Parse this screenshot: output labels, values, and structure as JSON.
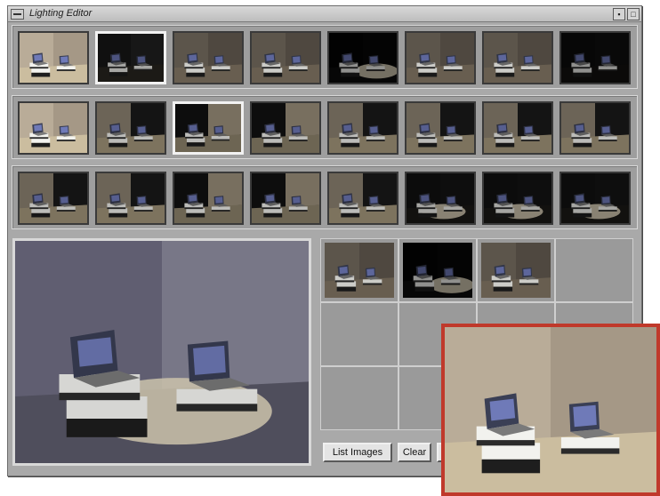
{
  "window": {
    "title": "Lighting Editor",
    "menu_icon": "window-menu-icon",
    "buttons": [
      "minimize-icon",
      "maximize-icon"
    ]
  },
  "rows": [
    {
      "thumbs": [
        {
          "light": "front",
          "selected": false
        },
        {
          "light": "dark-left",
          "selected": true
        },
        {
          "light": "dim-front",
          "selected": false
        },
        {
          "light": "dim-front",
          "selected": false
        },
        {
          "light": "spot-right",
          "selected": false
        },
        {
          "light": "dim-front",
          "selected": false
        },
        {
          "light": "dim-front",
          "selected": false
        },
        {
          "light": "dark",
          "selected": false
        }
      ]
    },
    {
      "thumbs": [
        {
          "light": "front",
          "selected": false
        },
        {
          "light": "side-left",
          "selected": false
        },
        {
          "light": "side-right",
          "selected": true
        },
        {
          "light": "side-right",
          "selected": false
        },
        {
          "light": "side-left",
          "selected": false
        },
        {
          "light": "side-left",
          "selected": false
        },
        {
          "light": "side-left",
          "selected": false
        },
        {
          "light": "side-left",
          "selected": false
        }
      ]
    },
    {
      "thumbs": [
        {
          "light": "side-left",
          "selected": false
        },
        {
          "light": "side-left",
          "selected": false
        },
        {
          "light": "side-right",
          "selected": false
        },
        {
          "light": "side-right",
          "selected": false
        },
        {
          "light": "side-left",
          "selected": false
        },
        {
          "light": "spot",
          "selected": false
        },
        {
          "light": "spot",
          "selected": false
        },
        {
          "light": "spot",
          "selected": false
        }
      ]
    }
  ],
  "preview": {
    "light": "spot-blue"
  },
  "palette": {
    "cells": [
      {
        "light": "dim-front"
      },
      {
        "light": "spot-right"
      },
      {
        "light": "dim-front"
      },
      {
        "light": "empty"
      },
      {
        "light": "empty"
      },
      {
        "light": "empty"
      },
      {
        "light": "empty"
      },
      {
        "light": "empty"
      },
      {
        "light": "empty"
      },
      {
        "light": "empty"
      },
      {
        "light": "empty"
      },
      {
        "light": "empty"
      }
    ]
  },
  "buttons": {
    "list_images": "List Images",
    "clear": "Clear"
  },
  "inset": {
    "light": "front"
  },
  "colors": {
    "inset_border": "#c0392b",
    "selected_border": "#f2f2f2"
  }
}
